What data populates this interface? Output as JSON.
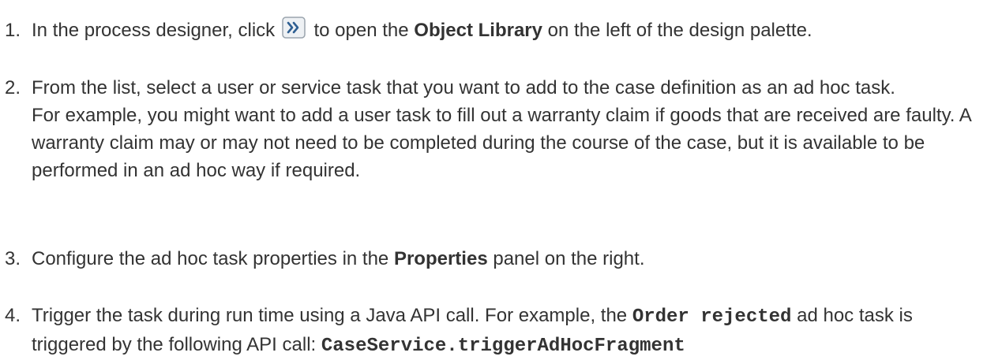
{
  "steps": [
    {
      "number": "1.",
      "before_icon": "In the process designer, click",
      "icon": "double-chevron-right-icon",
      "after_icon": "to open the",
      "bold": "Object Library",
      "after_bold": "on the left of the design palette."
    },
    {
      "number": "2.",
      "line1": "From the list, select a user or service task that you want to add to the case definition as an ad hoc task.",
      "line2": "For example, you might want to add a user task to fill out a warranty claim if goods that are received are faulty. A warranty claim may or may not need to be completed during the course of the case, but it is available to be performed in an ad hoc way if required."
    },
    {
      "number": "3.",
      "before_bold": "Configure the ad hoc task properties in the",
      "bold": "Properties",
      "after_bold": "panel on the right."
    },
    {
      "number": "4.",
      "before_code": "Trigger the task during run time using a Java API call. For example, the",
      "code1": "Order rejected",
      "middle": "ad hoc task is triggered by the following API call:",
      "code2": "CaseService.triggerAdHocFragment"
    }
  ],
  "colors": {
    "text": "#333333",
    "icon_border": "#9aa4ad",
    "icon_fill": "#eef1f4",
    "icon_glyph": "#2f5f92"
  }
}
